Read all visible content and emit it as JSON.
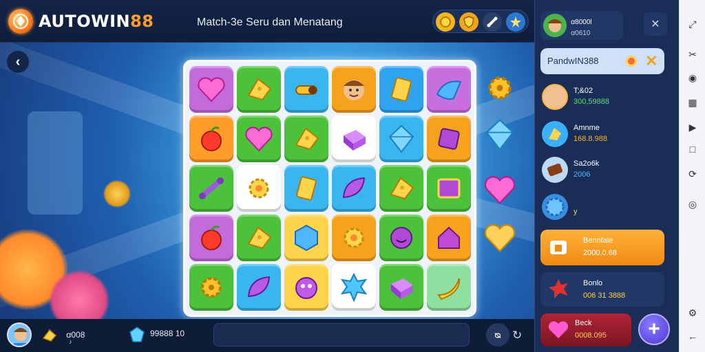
{
  "header": {
    "brand_prefix": "AUTOWIN",
    "brand_suffix": "88",
    "subtitle": "Match-3e Seru dan Menatang",
    "top_icons": [
      "coin-icon",
      "shield-icon",
      "bone-icon",
      "star-icon"
    ]
  },
  "window_controls": [
    "—",
    "☐",
    "✕"
  ],
  "stage": {
    "back_label": "‹",
    "board_tiles": [
      [
        "heart-icon",
        "cheese-icon",
        "gear-bone-icon",
        "face-icon",
        "gold-bar-icon",
        "wave-icon"
      ],
      [
        "apple-icon",
        "heart-icon",
        "cheese-icon",
        "cube-icon",
        "diamond-icon",
        "square-gem-icon"
      ],
      [
        "bone-icon",
        "flower-icon",
        "gold-bar-icon",
        "leaf-icon",
        "cheese-icon",
        "frame-icon"
      ],
      [
        "apple-icon",
        "cheese-icon",
        "hexagon-icon",
        "flower-icon",
        "smile-icon",
        "house-icon"
      ],
      [
        "gear-icon",
        "leaf-icon",
        "monster-icon",
        "splat-icon",
        "cube-icon",
        "banana-icon"
      ]
    ],
    "side_gems": [
      "gear-icon",
      "diamond-icon",
      "heart-icon",
      "heart-icon"
    ]
  },
  "bottom": {
    "stat1_value": "ꭤ008",
    "stat1_sub": "♪",
    "stat2_value": "99888 10",
    "undo_label": "ᴓ",
    "redo_label": "↻"
  },
  "panel": {
    "profile_name": "ꭤ8000l",
    "profile_sub": "ꭤ0610",
    "close_label": "✕",
    "search_text": "PandwIN388",
    "search_clear": "✕",
    "leaderboard": [
      {
        "name": "T;&02",
        "value": "300,59888",
        "color": "#58e070"
      },
      {
        "name": "Amnme",
        "value": "168.8.988",
        "color": "#f3b52f"
      },
      {
        "name": "Sa2o6k",
        "value": "2006",
        "color": "#4fb6ff"
      },
      {
        "name": "",
        "value": "y",
        "color": "#f3d84a"
      }
    ],
    "cards": [
      {
        "title": "Bennfale",
        "value": "2000.0.68",
        "bg": "#f59a1c"
      },
      {
        "title": "Bonlo",
        "value": "006 31 3888",
        "bg": "#213766"
      },
      {
        "title": "Beck",
        "value": "0008.095",
        "bg": "#8b1d2c"
      }
    ],
    "fab_label": "+"
  },
  "right_toolbar": [
    "expand-icon",
    "scissors-icon",
    "camera-icon",
    "grid-icon",
    "play-icon",
    "square-icon",
    "rotate-icon",
    "location-icon",
    "settings-icon",
    "back-icon"
  ]
}
